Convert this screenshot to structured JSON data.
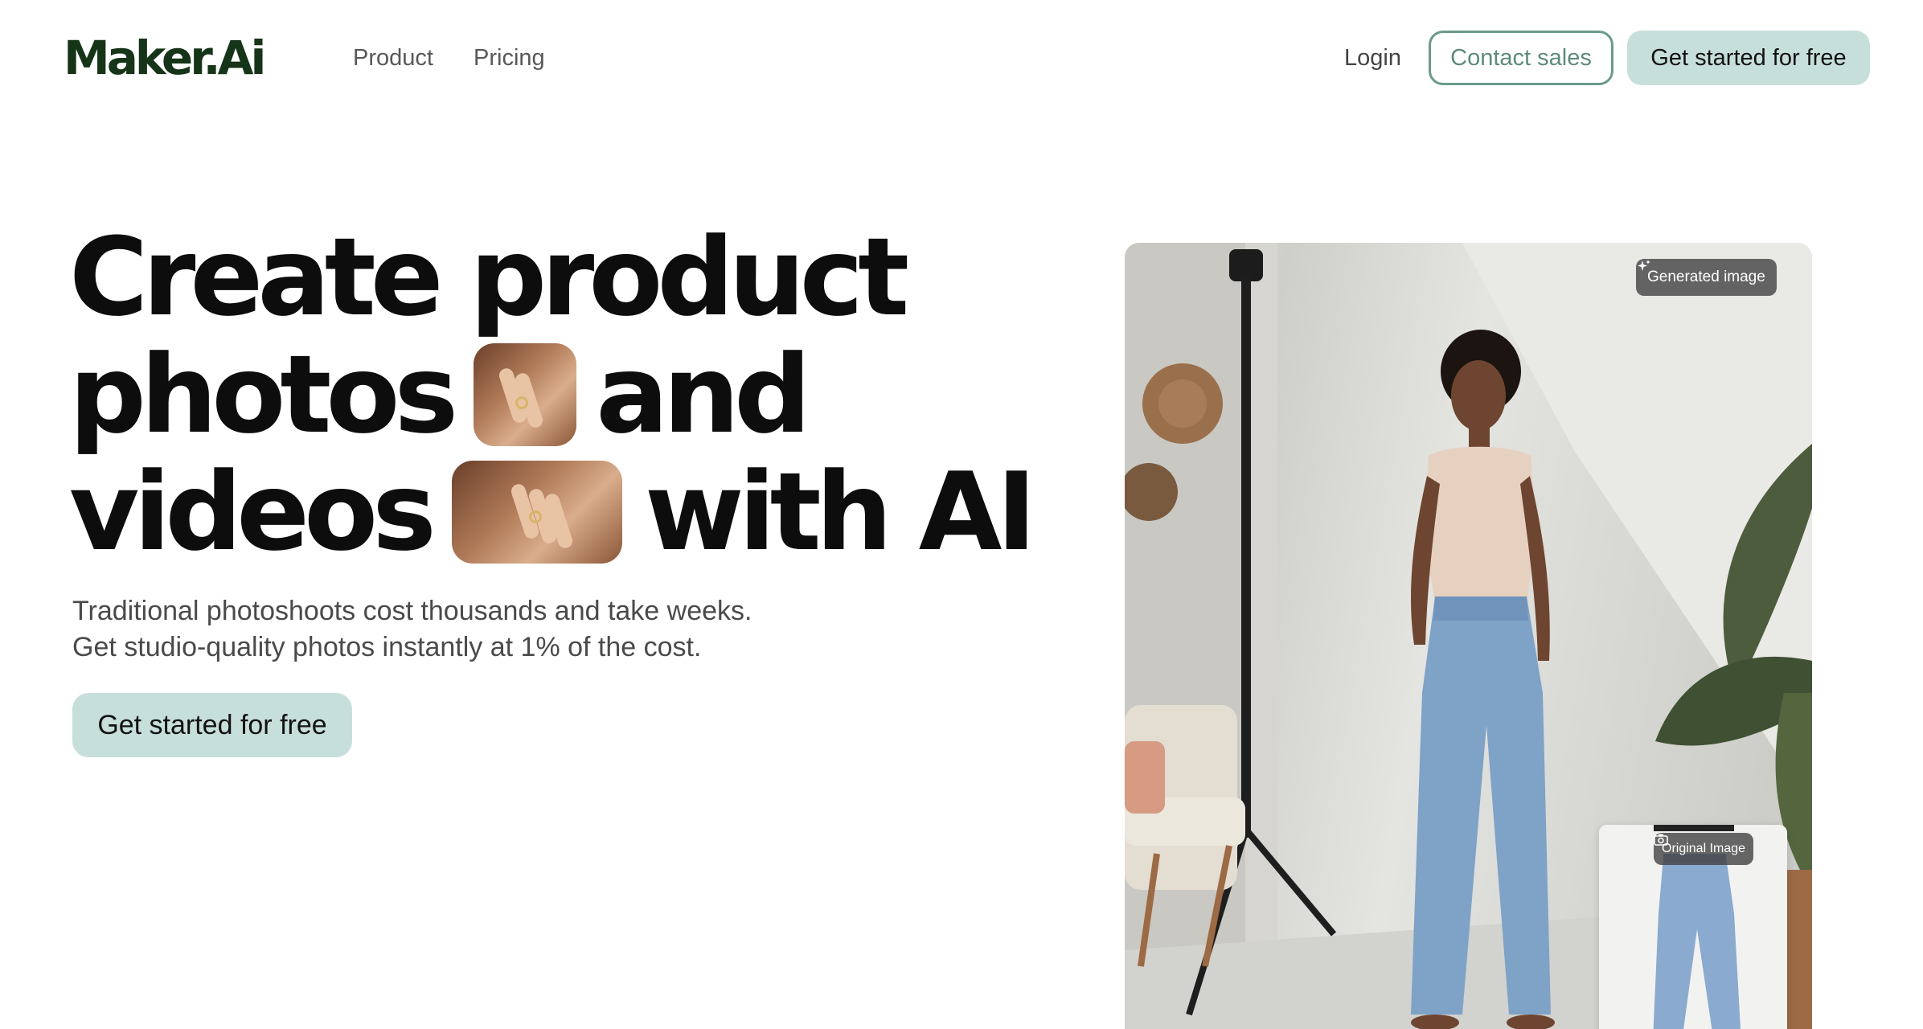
{
  "header": {
    "logo": "Maker.Ai",
    "nav": [
      "Product",
      "Pricing"
    ],
    "login": "Login",
    "contact_sales": "Contact sales",
    "get_started": "Get started for free"
  },
  "hero": {
    "title_lines": [
      [
        "Create product"
      ],
      [
        "photos",
        "and"
      ],
      [
        "videos",
        "with AI"
      ]
    ],
    "subtitle": [
      "Traditional photoshoots cost thousands and take weeks.",
      "Get studio-quality photos instantly at 1% of the cost."
    ],
    "cta": "Get started for free"
  },
  "image": {
    "generated_badge": "Generated image",
    "original_badge": "Original Image",
    "generated_icon": "sparkle-icon",
    "original_icon": "camera-icon"
  },
  "colors": {
    "logo": "#163417",
    "accent_button": "#c7dfda",
    "contact_border": "#6b9a8d"
  }
}
